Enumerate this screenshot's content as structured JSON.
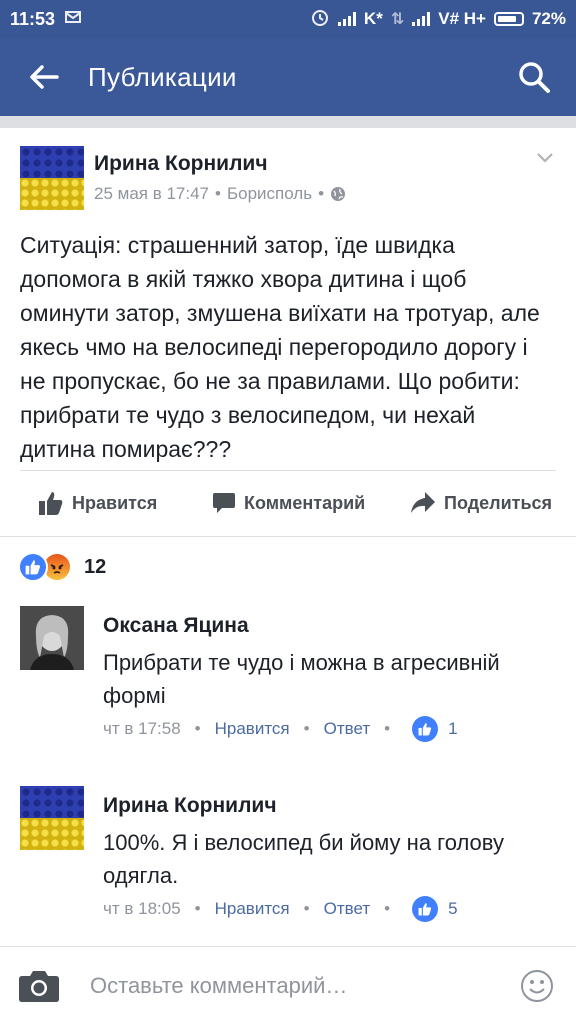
{
  "status_bar": {
    "time": "11:53",
    "carrier1": "K*",
    "carrier2": "V# H+",
    "battery": "72%"
  },
  "app_bar": {
    "title": "Публикации",
    "back_icon": "arrow-left-icon",
    "search_icon": "search-icon"
  },
  "post": {
    "author": "Ирина Корнилич",
    "date": "25 мая в 17:47",
    "location": "Борисполь",
    "separator": "•",
    "privacy_icon": "globe-icon",
    "text": "Ситуація: страшенний затор, їде швидка допомога в якій тяжко хвора дитина і щоб оминути затор, змушена виїхати на тротуар, але якесь чмо на велосипеді перегородило дорогу і не пропускає, бо не за правилами. Що робити: прибрати те чудо з велосипедом, чи нехай дитина помирає???",
    "actions": {
      "like": "Нравится",
      "comment": "Комментарий",
      "share": "Поделиться"
    },
    "reactions_count": "12"
  },
  "comments": [
    {
      "author": "Оксана Яцина",
      "text": "Прибрати те чудо і можна в агресивній формі",
      "time": "чт в 17:58",
      "like": "Нравится",
      "reply": "Ответ",
      "likes": "1"
    },
    {
      "author": "Ирина Корнилич",
      "text": "100%. Я і велосипед би йому на голову одягла.",
      "time": "чт в 18:05",
      "like": "Нравится",
      "reply": "Ответ",
      "likes": "5"
    }
  ],
  "composer": {
    "placeholder": "Оставьте комментарий…"
  },
  "colors": {
    "brand": "#3b5998",
    "like_blue": "#4080ff",
    "link": "#4b6ba3"
  }
}
